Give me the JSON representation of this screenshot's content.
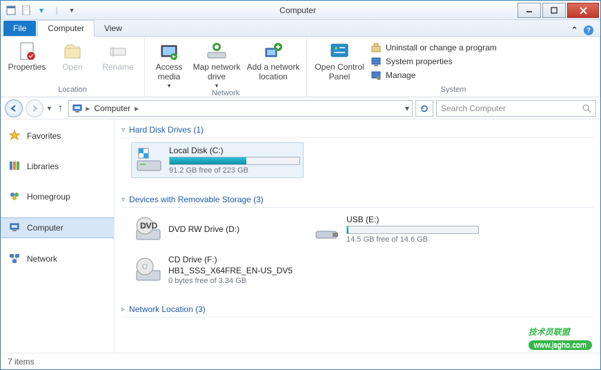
{
  "window": {
    "title": "Computer"
  },
  "tabs": {
    "file": "File",
    "computer": "Computer",
    "view": "View"
  },
  "ribbon": {
    "location": {
      "label": "Location",
      "properties": "Properties",
      "open": "Open",
      "rename": "Rename"
    },
    "network": {
      "label": "Network",
      "access": "Access media",
      "map": "Map network drive",
      "add": "Add a network location"
    },
    "system": {
      "label": "System",
      "panel": "Open Control Panel",
      "uninstall": "Uninstall or change a program",
      "props": "System properties",
      "manage": "Manage"
    }
  },
  "address": {
    "root": "Computer"
  },
  "search": {
    "placeholder": "Search Computer"
  },
  "nav": {
    "favorites": "Favorites",
    "libraries": "Libraries",
    "homegroup": "Homegroup",
    "computer": "Computer",
    "network": "Network"
  },
  "sections": {
    "hdd": {
      "title": "Hard Disk Drives (1)"
    },
    "removable": {
      "title": "Devices with Removable Storage (3)"
    },
    "netloc": {
      "title": "Network Location (3)"
    }
  },
  "drives": {
    "local": {
      "name": "Local Disk (C:)",
      "free": "91.2 GB free of 223 GB",
      "pct": 59
    },
    "dvd": {
      "name": "DVD RW Drive (D:)"
    },
    "usb": {
      "name": "USB (E:)",
      "free": "14.5 GB free of 14.6 GB",
      "pct": 1
    },
    "cd": {
      "name": "CD Drive (F:)",
      "label": "HB1_SSS_X64FRE_EN-US_DV5",
      "free": "0 bytes free of 3.34 GB"
    }
  },
  "status": {
    "count": "7 items"
  },
  "watermark": {
    "text": "技术员联盟",
    "url": "www.jsgho.com"
  }
}
